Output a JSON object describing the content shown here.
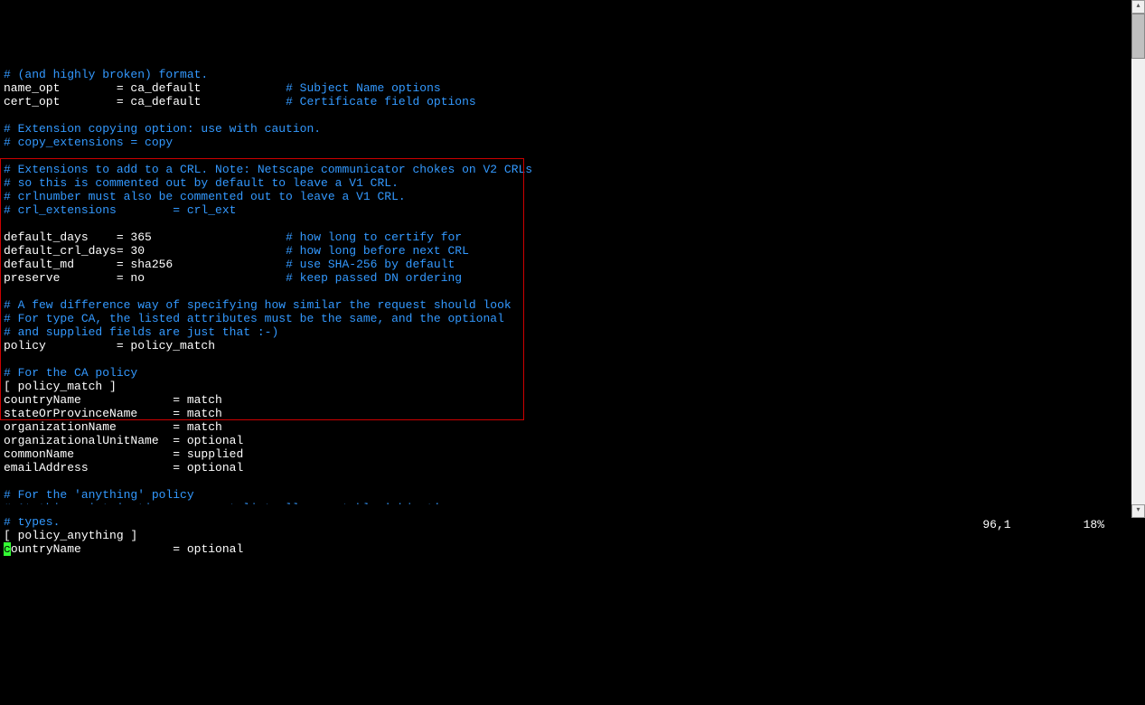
{
  "lines": {
    "l1_c": "# (and highly broken) format.",
    "l2_t": "name_opt        = ca_default            ",
    "l2_c": "# Subject Name options",
    "l3_t": "cert_opt        = ca_default            ",
    "l3_c": "# Certificate field options",
    "l5_c": "# Extension copying option: use with caution.",
    "l6_c": "# copy_extensions = copy",
    "l8_c": "# Extensions to add to a CRL. Note: Netscape communicator chokes on V2 CRLs",
    "l9_c": "# so this is commented out by default to leave a V1 CRL.",
    "l10_c": "# crlnumber must also be commented out to leave a V1 CRL.",
    "l11_c": "# crl_extensions        = crl_ext",
    "l13_t": "default_days    = 365                   ",
    "l13_c": "# how long to certify for",
    "l14_t": "default_crl_days= 30                    ",
    "l14_c": "# how long before next CRL",
    "l15_t": "default_md      = sha256                ",
    "l15_c": "# use SHA-256 by default",
    "l16_t": "preserve        = no                    ",
    "l16_c": "# keep passed DN ordering",
    "l18_c": "# A few difference way of specifying how similar the request should look",
    "l19_c": "# For type CA, the listed attributes must be the same, and the optional",
    "l20_c": "# and supplied fields are just that :-)",
    "l21_t": "policy          = policy_match",
    "l23_c": "# For the CA policy",
    "l24_t": "[ policy_match ]",
    "l25_t": "countryName             = match",
    "l26_t": "stateOrProvinceName     = match",
    "l27_t": "organizationName        = match",
    "l28_t": "organizationalUnitName  = optional",
    "l29_t": "commonName              = supplied",
    "l30_t": "emailAddress            = optional",
    "l32_c": "# For the 'anything' policy",
    "l33_c": "# At this point in time, you must list all acceptable 'object'",
    "l34_c": "# types.",
    "l35_t": "[ policy_anything ]",
    "l36_cursor": "c",
    "l36_t": "ountryName             = optional"
  },
  "status": {
    "position": "96,1",
    "percent": "18%"
  },
  "scrollbar": {
    "up": "▴",
    "down": "▾"
  }
}
